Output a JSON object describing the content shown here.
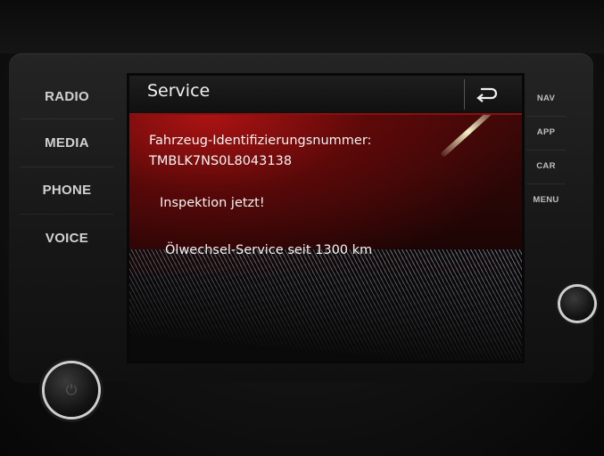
{
  "left_buttons": [
    {
      "label": "RADIO"
    },
    {
      "label": "MEDIA"
    },
    {
      "label": "PHONE"
    },
    {
      "label": "VOICE"
    }
  ],
  "right_buttons": [
    {
      "label": "NAV"
    },
    {
      "label": "APP"
    },
    {
      "label": "CAR"
    },
    {
      "label": "MENU"
    }
  ],
  "screen": {
    "title": "Service",
    "back_icon": "back-arrow-icon",
    "vin_label": "Fahrzeug-Identifizierungsnummer:",
    "vin_value": "TMBLK7NS0L8043138",
    "inspection_text": "Inspektion jetzt!",
    "oil_service_text": "Ölwechsel-Service seit 1300 km"
  },
  "colors": {
    "accent_red": "#8a1010",
    "text": "#f4f4f4",
    "button_text": "#d2d2d2"
  }
}
